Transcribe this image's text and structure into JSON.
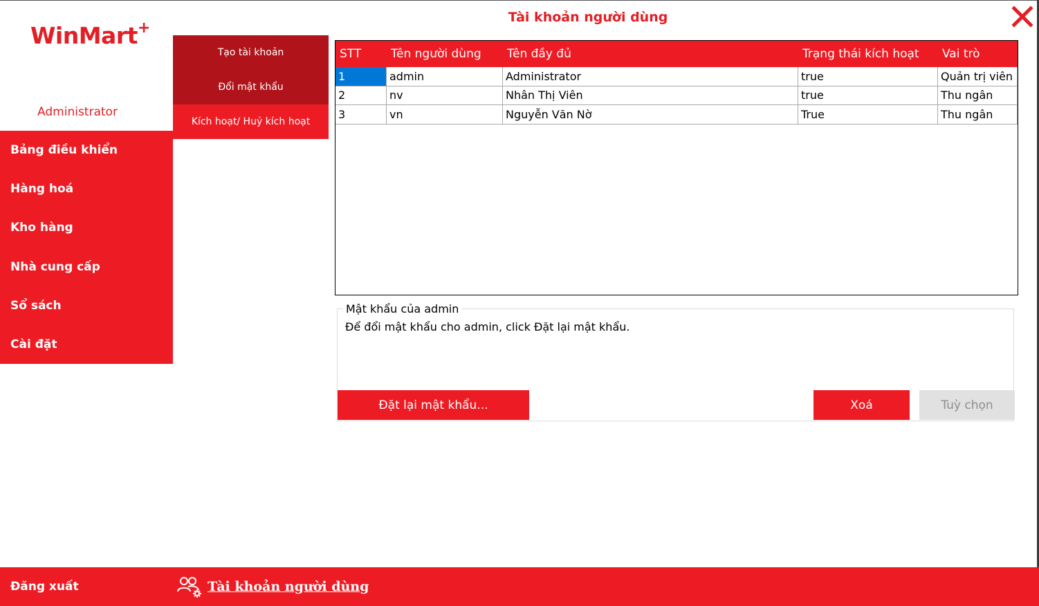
{
  "window": {
    "title": "Tài khoản người dùng",
    "close_icon": "close-icon",
    "colors": {
      "accent": "#ed1c24",
      "accent_dark": "#b01319",
      "title_red": "#e31e24",
      "selection": "#0078d7"
    }
  },
  "logo": {
    "text": "WinMart",
    "plus": "+"
  },
  "user": {
    "display_name": "Administrator"
  },
  "sidebar": {
    "items": [
      {
        "label": "Bảng điều khiển"
      },
      {
        "label": "Hàng hoá"
      },
      {
        "label": "Kho hàng"
      },
      {
        "label": "Nhà cung cấp"
      },
      {
        "label": "Sổ sách"
      },
      {
        "label": "Cài đặt"
      }
    ]
  },
  "submenu": {
    "items": [
      {
        "label": "Tạo tài khoản",
        "state": "normal"
      },
      {
        "label": "Đổi mật khẩu",
        "state": "normal"
      },
      {
        "label": "Kích hoạt/ Huỷ kích hoạt",
        "state": "active"
      }
    ]
  },
  "grid": {
    "columns": [
      "STT",
      "Tên người dùng",
      "Tên đầy đủ",
      "Trạng thái kích hoạt",
      "Vai trò"
    ],
    "rows": [
      [
        "1",
        "admin",
        "Administrator",
        "true",
        "Quản trị viên"
      ],
      [
        "2",
        "nv",
        "Nhân Thị Viên",
        "true",
        "Thu ngân"
      ],
      [
        "3",
        "vn",
        "Nguyễn Văn Nờ",
        "True",
        "Thu ngân"
      ]
    ],
    "selected_cell": {
      "row": 0,
      "col": 0
    }
  },
  "password_group": {
    "legend": "Mật khẩu của admin",
    "description": "Để đổi mật khẩu cho admin, click Đặt lại mật khẩu."
  },
  "buttons": {
    "reset_password": "Đặt lại mật khẩu...",
    "delete": "Xoá",
    "options": "Tuỳ chọn"
  },
  "footer": {
    "logout": "Đăng xuất",
    "section_link": "Tài khoản người dùng",
    "section_icon": "users-gear-icon"
  }
}
